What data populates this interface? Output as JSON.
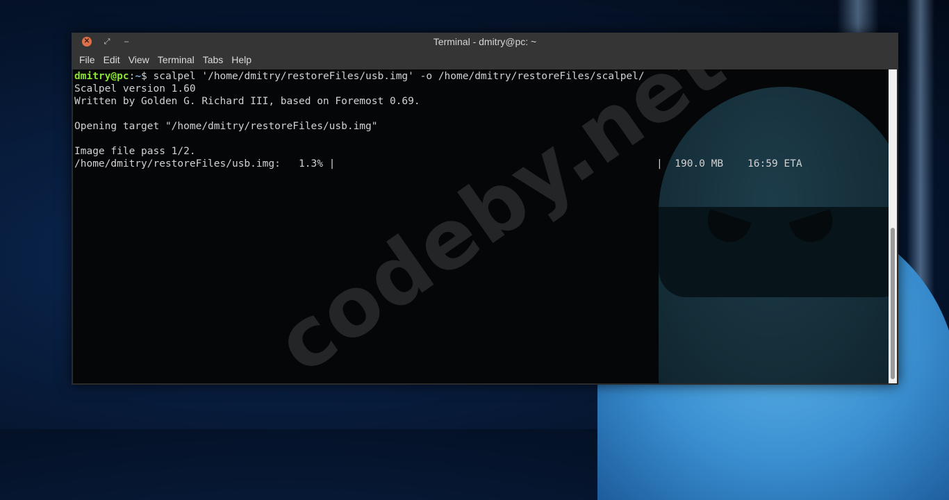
{
  "window": {
    "title": "Terminal - dmitry@pc: ~",
    "close_icon": "close-icon",
    "restore_glyph": "⤢",
    "minimize_glyph": "‒"
  },
  "menu": {
    "items": [
      "File",
      "Edit",
      "View",
      "Terminal",
      "Tabs",
      "Help"
    ]
  },
  "terminal": {
    "prompt_user": "dmitry@pc",
    "prompt_sep": ":",
    "prompt_path": "~",
    "prompt_symbol": "$ ",
    "command": "scalpel '/home/dmitry/restoreFiles/usb.img' -o /home/dmitry/restoreFiles/scalpel/",
    "output": [
      "Scalpel version 1.60",
      "Written by Golden G. Richard III, based on Foremost 0.69.",
      "",
      "Opening target \"/home/dmitry/restoreFiles/usb.img\"",
      "",
      "Image file pass 1/2.",
      "/home/dmitry/restoreFiles/usb.img:   1.3% |                                                     |  190.0 MB    16:59 ETA"
    ]
  },
  "watermark": "codeby.net"
}
